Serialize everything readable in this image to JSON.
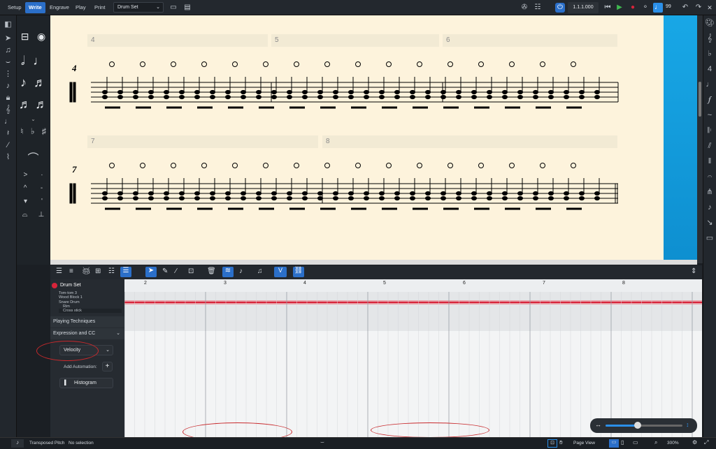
{
  "modes": [
    "Setup",
    "Write",
    "Engrave",
    "Play",
    "Print"
  ],
  "active_mode": "Write",
  "instrument_select": "Drum Set",
  "time_display": "1.1.1.000",
  "tempo": "99",
  "bars_top": [
    "4",
    "5",
    "6"
  ],
  "bars_bottom": [
    "7",
    "8"
  ],
  "system_numbers": [
    "4",
    "7"
  ],
  "ruler": [
    "2",
    "3",
    "4",
    "5",
    "6",
    "7",
    "8"
  ],
  "track": {
    "name": "Drum Set",
    "lanes": [
      "Tom-tom 3",
      "Wood Block 1",
      "Snare Drum",
      "Rim",
      "Cross stick"
    ]
  },
  "playing_techniques": "Playing Techniques",
  "expression": "Expression and CC",
  "velocity": "Velocity",
  "add_automation": "Add Automation:",
  "histogram": "Histogram",
  "status": {
    "transposed": "Transposed Pitch",
    "selection": "No selection",
    "view": "Page View",
    "zoom": "300%"
  },
  "icons": [
    "grid-icon",
    "pointer-icon",
    "pencil-icon",
    "line-icon",
    "trash-icon",
    "note-icon",
    "link-icon",
    "palette-icon",
    "gear-icon",
    "play-icon",
    "record-icon",
    "rewind-icon",
    "metronome-icon",
    "mixer-icon",
    "video-icon"
  ],
  "colors": {
    "accent": "#2b6fc9",
    "record": "#d8243a",
    "play": "#3fb950"
  }
}
